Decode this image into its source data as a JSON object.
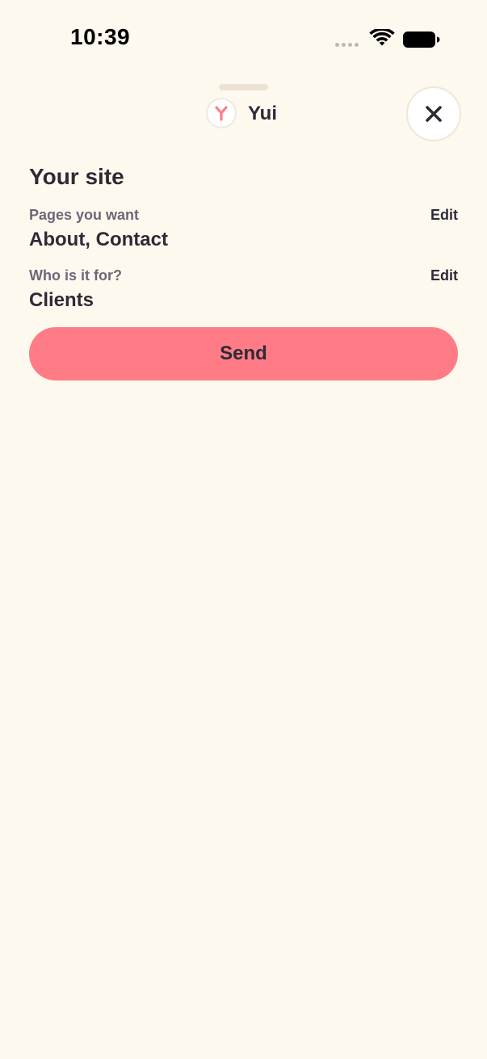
{
  "status_bar": {
    "time": "10:39",
    "icons": [
      "signal-dots",
      "wifi-icon",
      "battery-icon"
    ]
  },
  "header": {
    "assistant_name": "Yui",
    "avatar_icon": "yui-logo-icon",
    "close_icon": "close-icon"
  },
  "summary": {
    "title": "Your site",
    "fields": [
      {
        "label": "Pages you want",
        "value": "About, Contact",
        "edit_label": "Edit"
      },
      {
        "label": "Who is it for?",
        "value": "Clients",
        "edit_label": "Edit"
      }
    ]
  },
  "actions": {
    "send_label": "Send"
  },
  "colors": {
    "background": "#FEF9EE",
    "accent": "#FF7C86",
    "text": "#2E2A36",
    "muted_text": "#6E6678"
  }
}
